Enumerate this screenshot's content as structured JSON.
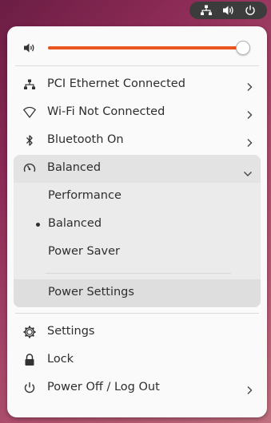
{
  "topbar": {
    "icons": [
      "network-wired-icon",
      "volume-icon",
      "power-icon"
    ]
  },
  "volume": {
    "icon": "volume-icon",
    "level": 1.0,
    "accent": "#e95420"
  },
  "items": {
    "ethernet": {
      "icon": "network-wired-icon",
      "label": "PCI Ethernet Connected"
    },
    "wifi": {
      "icon": "wifi-icon",
      "label": "Wi-Fi Not Connected"
    },
    "bluetooth": {
      "icon": "bluetooth-icon",
      "label": "Bluetooth On"
    }
  },
  "power_mode": {
    "icon": "power-profile-icon",
    "label": "Balanced",
    "expanded": true,
    "options": [
      {
        "label": "Performance",
        "selected": false
      },
      {
        "label": "Balanced",
        "selected": true
      },
      {
        "label": "Power Saver",
        "selected": false
      }
    ],
    "settings_label": "Power Settings"
  },
  "footer": {
    "settings": {
      "icon": "gear-icon",
      "label": "Settings"
    },
    "lock": {
      "icon": "lock-icon",
      "label": "Lock"
    },
    "power_off": {
      "icon": "power-icon",
      "label": "Power Off / Log Out"
    }
  }
}
